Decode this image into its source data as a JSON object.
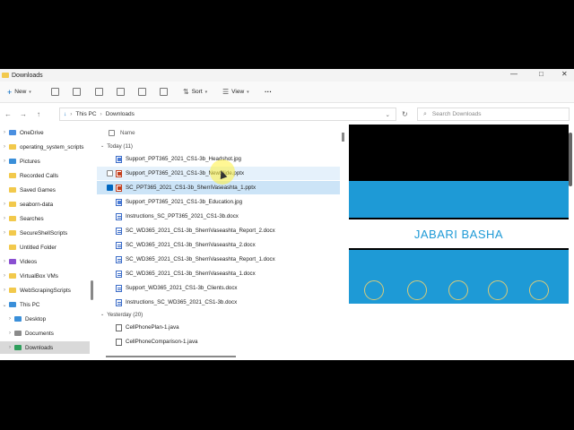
{
  "window": {
    "title": "Downloads"
  },
  "toolbar": {
    "new_label": "New",
    "sort_label": "Sort",
    "view_label": "View",
    "more_label": "···"
  },
  "address": {
    "crumbs": [
      "This PC",
      "Downloads"
    ]
  },
  "search": {
    "placeholder": "Search Downloads"
  },
  "sidebar": {
    "items": [
      {
        "label": "OneDrive",
        "icon": "cloud-icon"
      },
      {
        "label": "operating_system_scripts",
        "icon": "folder-icon"
      },
      {
        "label": "Pictures",
        "icon": "pictures-icon"
      },
      {
        "label": "Recorded Calls",
        "icon": "folder-icon"
      },
      {
        "label": "Saved Games",
        "icon": "folder-icon"
      },
      {
        "label": "seaborn-data",
        "icon": "folder-icon"
      },
      {
        "label": "Searches",
        "icon": "search-folder-icon"
      },
      {
        "label": "SecureShellScripts",
        "icon": "folder-icon"
      },
      {
        "label": "Untitled Folder",
        "icon": "folder-icon"
      },
      {
        "label": "Videos",
        "icon": "videos-icon"
      },
      {
        "label": "VirtualBox VMs",
        "icon": "folder-icon"
      },
      {
        "label": "WebScrapingScripts",
        "icon": "folder-icon"
      },
      {
        "label": "This PC",
        "icon": "pc-icon"
      },
      {
        "label": "Desktop",
        "icon": "desktop-icon"
      },
      {
        "label": "Documents",
        "icon": "documents-icon"
      },
      {
        "label": "Downloads",
        "icon": "downloads-icon"
      }
    ]
  },
  "filelist": {
    "column_name": "Name",
    "groups": [
      {
        "label": "Today (11)"
      },
      {
        "label": "Yesterday (20)"
      }
    ],
    "today": [
      {
        "name": "Support_PPT365_2021_CS1-3b_Headshot.jpg",
        "type": "img"
      },
      {
        "name": "Support_PPT365_2021_CS1-3b_NewSlide.pptx",
        "type": "ppt"
      },
      {
        "name": "SC_PPT365_2021_CS1-3b_SherriVaseashta_1.pptx",
        "type": "ppt"
      },
      {
        "name": "Support_PPT365_2021_CS1-3b_Education.jpg",
        "type": "img"
      },
      {
        "name": "Instructions_SC_PPT365_2021_CS1-3b.docx",
        "type": "doc"
      },
      {
        "name": "SC_WD365_2021_CS1-3b_SherriVaseashta_Report_2.docx",
        "type": "doc"
      },
      {
        "name": "SC_WD365_2021_CS1-3b_SherriVaseashta_2.docx",
        "type": "doc"
      },
      {
        "name": "SC_WD365_2021_CS1-3b_SherriVaseashta_Report_1.docx",
        "type": "doc"
      },
      {
        "name": "SC_WD365_2021_CS1-3b_SherriVaseashta_1.docx",
        "type": "doc"
      },
      {
        "name": "Support_WD365_2021_CS1-3b_Clients.docx",
        "type": "doc"
      },
      {
        "name": "Instructions_SC_WD365_2021_CS1-3b.docx",
        "type": "doc"
      }
    ],
    "yesterday": [
      {
        "name": "CellPhonePlan-1.java",
        "type": "java"
      },
      {
        "name": "CellPhoneComparison-1.java",
        "type": "java"
      }
    ]
  },
  "preview": {
    "slide_title": "JABARI BASHA",
    "accent": "#1e9ad6"
  }
}
